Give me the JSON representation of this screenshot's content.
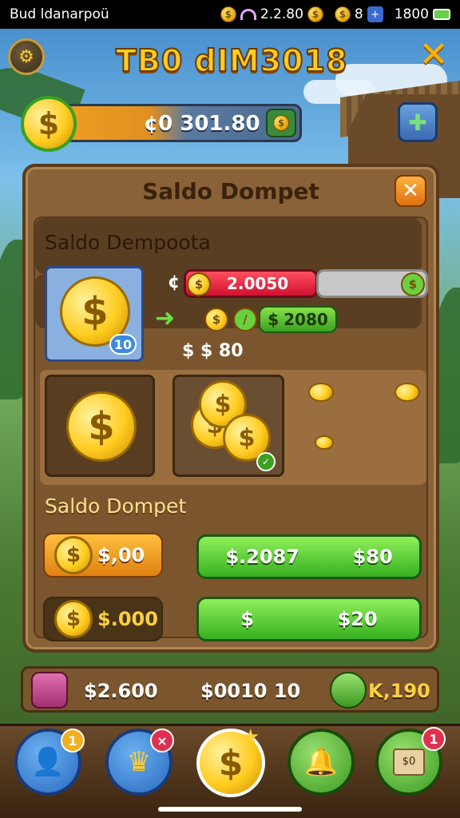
{
  "status_bar": {
    "carrier": "Bud ldanarpoü",
    "coins_value": "2.2.80",
    "gems_value": "8",
    "battery_value": "1800"
  },
  "header": {
    "logo_text": "TB0 dIM3018"
  },
  "balance": {
    "amount": "301.80",
    "prefix": "¢0"
  },
  "panel": {
    "title": "Saldo Dompet",
    "section1_title": "Saldo Dempoota",
    "coin_badge": "10",
    "hp_prefix": "¢",
    "hp_value": "2.0050",
    "green_value": "2080",
    "cost_line": "$  $ 80",
    "section2_title": "Saldo Dompet",
    "row1_left": "$,00",
    "row1_mid": "$.2087",
    "row1_right": "$80",
    "row2_left": "$.000",
    "row2_mid": "$",
    "row2_right": "$20"
  },
  "footer_strip": {
    "left_value": "$2.600",
    "mid_value": "$0010 10",
    "right_value": "K,190"
  },
  "nav": {
    "badge_profile": "1",
    "badge_shop": "×",
    "badge_gift": "1",
    "gift_label": "$0"
  }
}
